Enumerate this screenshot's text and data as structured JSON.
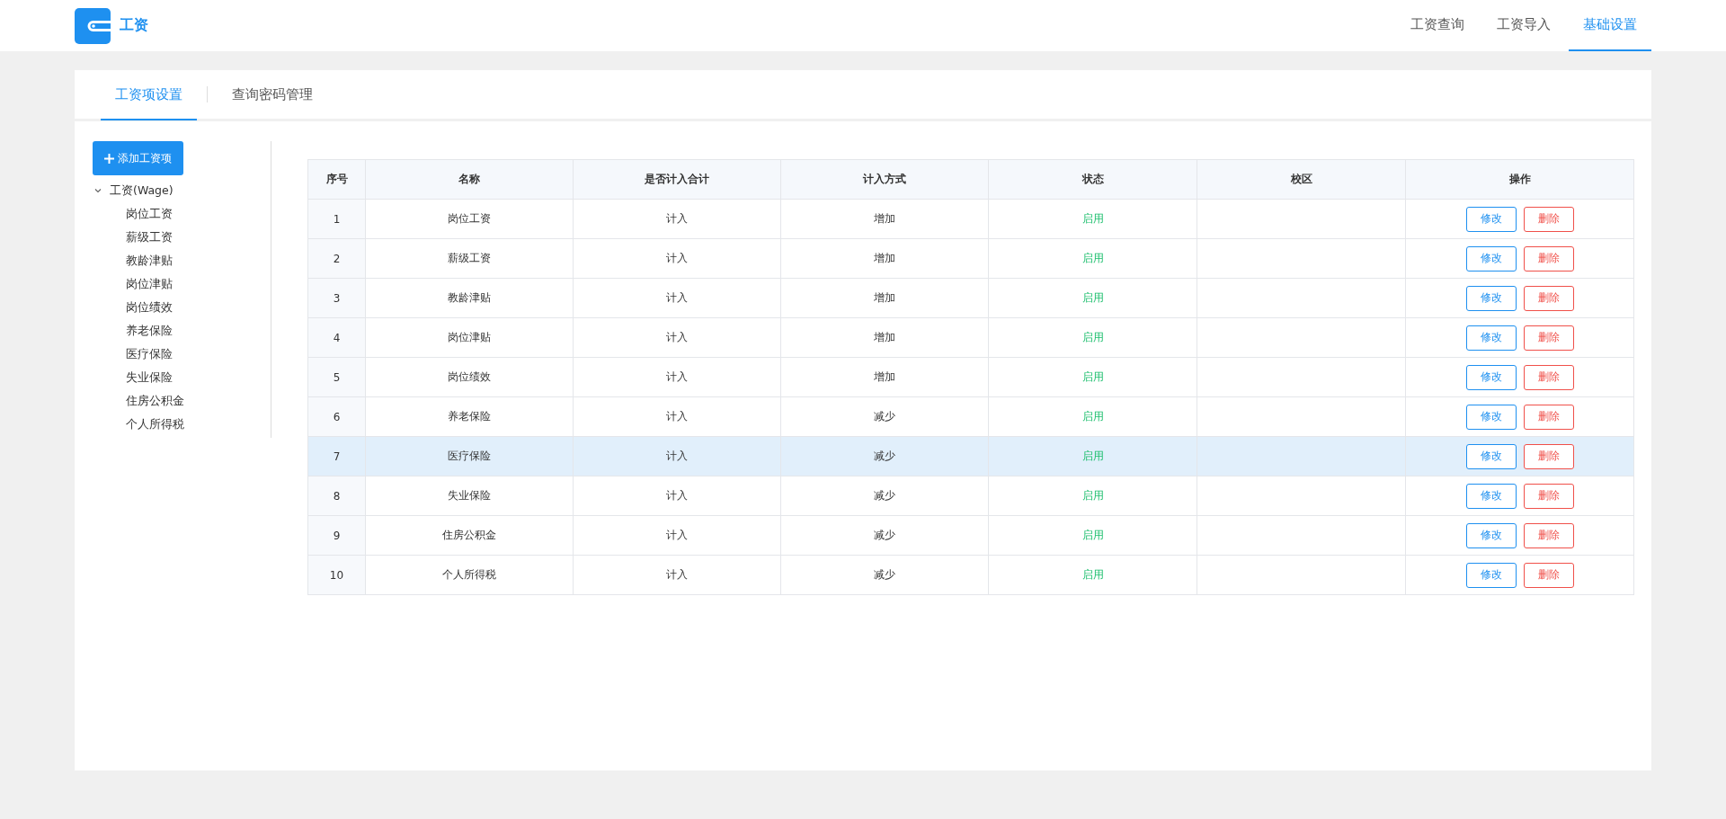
{
  "app": {
    "title": "工资"
  },
  "nav": [
    {
      "label": "工资查询",
      "selected": false
    },
    {
      "label": "工资导入",
      "selected": false
    },
    {
      "label": "基础设置",
      "selected": true
    }
  ],
  "tabs": [
    {
      "label": "工资项设置",
      "selected": true
    },
    {
      "label": "查询密码管理",
      "selected": false
    }
  ],
  "add_button": {
    "label": "添加工资项"
  },
  "tree": {
    "label": "工资(Wage)",
    "expanded": true,
    "children": [
      {
        "label": "岗位工资"
      },
      {
        "label": "薪级工资"
      },
      {
        "label": "教龄津贴"
      },
      {
        "label": "岗位津贴"
      },
      {
        "label": "岗位绩效"
      },
      {
        "label": "养老保险"
      },
      {
        "label": "医疗保险"
      },
      {
        "label": "失业保险"
      },
      {
        "label": "住房公积金"
      },
      {
        "label": "个人所得税"
      }
    ]
  },
  "table": {
    "columns": [
      "序号",
      "名称",
      "是否计入合计",
      "计入方式",
      "状态",
      "校区",
      "操作"
    ],
    "rows": [
      {
        "no": "1",
        "name": "岗位工资",
        "included": "计入",
        "mode": "增加",
        "status": "启用",
        "enabled": true,
        "hovered": false,
        "actions": [
          {
            "label": "修改",
            "kind": "edit"
          },
          {
            "label": "删除",
            "kind": "delete"
          }
        ]
      },
      {
        "no": "2",
        "name": "薪级工资",
        "included": "计入",
        "mode": "增加",
        "status": "启用",
        "enabled": true,
        "hovered": false,
        "actions": [
          {
            "label": "修改",
            "kind": "edit"
          },
          {
            "label": "删除",
            "kind": "delete"
          }
        ]
      },
      {
        "no": "3",
        "name": "教龄津贴",
        "included": "计入",
        "mode": "增加",
        "status": "启用",
        "enabled": true,
        "hovered": false,
        "actions": [
          {
            "label": "修改",
            "kind": "edit"
          },
          {
            "label": "删除",
            "kind": "delete"
          }
        ]
      },
      {
        "no": "4",
        "name": "岗位津贴",
        "included": "计入",
        "mode": "增加",
        "status": "启用",
        "enabled": true,
        "hovered": false,
        "actions": [
          {
            "label": "修改",
            "kind": "edit"
          },
          {
            "label": "删除",
            "kind": "delete"
          }
        ]
      },
      {
        "no": "5",
        "name": "岗位绩效",
        "included": "计入",
        "mode": "增加",
        "status": "启用",
        "enabled": true,
        "hovered": false,
        "actions": [
          {
            "label": "修改",
            "kind": "edit"
          },
          {
            "label": "删除",
            "kind": "delete"
          }
        ]
      },
      {
        "no": "6",
        "name": "养老保险",
        "included": "计入",
        "mode": "减少",
        "status": "启用",
        "enabled": true,
        "hovered": false,
        "actions": [
          {
            "label": "修改",
            "kind": "edit"
          },
          {
            "label": "删除",
            "kind": "delete"
          }
        ]
      },
      {
        "no": "7",
        "name": "医疗保险",
        "included": "计入",
        "mode": "减少",
        "status": "启用",
        "enabled": true,
        "hovered": true,
        "actions": [
          {
            "label": "修改",
            "kind": "edit"
          },
          {
            "label": "删除",
            "kind": "delete"
          }
        ]
      },
      {
        "no": "8",
        "name": "失业保险",
        "included": "计入",
        "mode": "减少",
        "status": "启用",
        "enabled": true,
        "hovered": false,
        "actions": [
          {
            "label": "修改",
            "kind": "edit"
          },
          {
            "label": "删除",
            "kind": "delete"
          }
        ]
      },
      {
        "no": "9",
        "name": "住房公积金",
        "included": "计入",
        "mode": "减少",
        "status": "启用",
        "enabled": true,
        "hovered": false,
        "actions": [
          {
            "label": "修改",
            "kind": "edit"
          },
          {
            "label": "删除",
            "kind": "delete"
          }
        ]
      },
      {
        "no": "10",
        "name": "个人所得税",
        "included": "计入",
        "mode": "减少",
        "status": "启用",
        "enabled": true,
        "hovered": false,
        "actions": [
          {
            "label": "修改",
            "kind": "edit"
          },
          {
            "label": "删除",
            "kind": "delete"
          }
        ]
      }
    ]
  }
}
